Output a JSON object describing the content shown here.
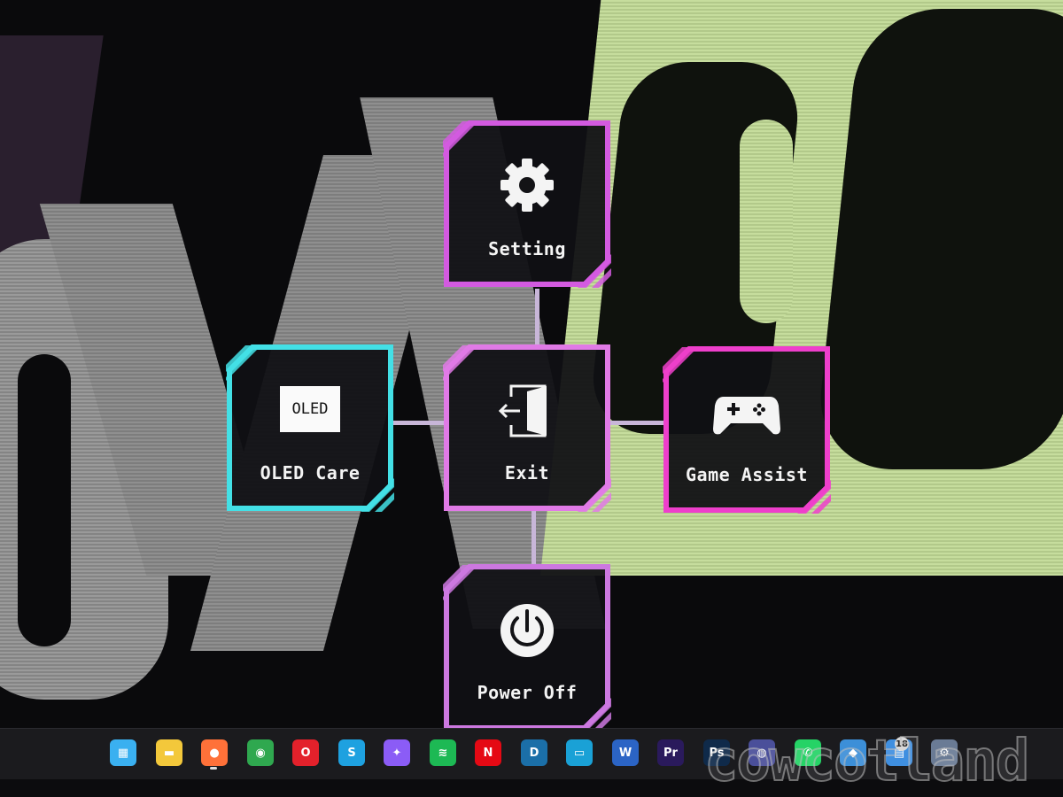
{
  "osd_menu": {
    "setting_label": "Setting",
    "exit_label": "Exit",
    "oled_care_label": "OLED Care",
    "oled_badge_text": "OLED",
    "game_assist_label": "Game Assist",
    "power_off_label": "Power Off"
  },
  "colors": {
    "setting_frame": "#d35ae0",
    "exit_frame": "#e07ae6",
    "oled_frame": "#43e0e6",
    "game_frame": "#ee3fcb",
    "power_frame": "#cc78e0"
  },
  "icons": {
    "setting": "gear-icon",
    "exit": "exit-door-icon",
    "oled": "oled-badge-icon",
    "game": "gamepad-icon",
    "power": "power-icon"
  },
  "taskbar": {
    "apps": [
      {
        "name": "Start",
        "icon": "windows-start-icon",
        "color": "#3ab0f0",
        "glyph": "▦"
      },
      {
        "name": "File Explorer",
        "icon": "folder-icon",
        "color": "#f3c83b",
        "glyph": "▬"
      },
      {
        "name": "Firefox",
        "icon": "firefox-icon",
        "color": "#ff7139",
        "glyph": "●"
      },
      {
        "name": "Chrome",
        "icon": "chrome-icon",
        "color": "#2fa84f",
        "glyph": "◉"
      },
      {
        "name": "Opera",
        "icon": "opera-icon",
        "color": "#e3212b",
        "glyph": "O"
      },
      {
        "name": "Skype",
        "icon": "skype-icon",
        "color": "#1ea1e0",
        "glyph": "S"
      },
      {
        "name": "Messenger",
        "icon": "messenger-icon",
        "color": "#8b5cf6",
        "glyph": "✦"
      },
      {
        "name": "Spotify",
        "icon": "spotify-icon",
        "color": "#1db954",
        "glyph": "≋"
      },
      {
        "name": "Netflix",
        "icon": "netflix-icon",
        "color": "#e50914",
        "glyph": "N"
      },
      {
        "name": "Disney+",
        "icon": "disney-plus-icon",
        "color": "#1b6fa8",
        "glyph": "D"
      },
      {
        "name": "Prime Video",
        "icon": "prime-video-icon",
        "color": "#1aa1d6",
        "glyph": "▭"
      },
      {
        "name": "Word",
        "icon": "word-icon",
        "color": "#2b64c5",
        "glyph": "W"
      },
      {
        "name": "Premiere Pro",
        "icon": "premiere-icon",
        "color": "#2a1a5c",
        "glyph": "Pr"
      },
      {
        "name": "Photoshop",
        "icon": "photoshop-icon",
        "color": "#0f2a4a",
        "glyph": "Ps"
      },
      {
        "name": "App",
        "icon": "generic-app-icon",
        "color": "#4a4f9a",
        "glyph": "◍"
      },
      {
        "name": "WhatsApp",
        "icon": "whatsapp-icon",
        "color": "#25d366",
        "glyph": "✆"
      },
      {
        "name": "App",
        "icon": "generic-app-icon",
        "color": "#3c8fd8",
        "glyph": "◆"
      },
      {
        "name": "App",
        "icon": "generic-app-icon",
        "color": "#3f8fe0",
        "glyph": "▤"
      },
      {
        "name": "Settings",
        "icon": "settings-gear-icon",
        "color": "#6a7b95",
        "glyph": "⚙"
      }
    ],
    "badge_count": "18"
  },
  "watermark_text": "cowcotland"
}
